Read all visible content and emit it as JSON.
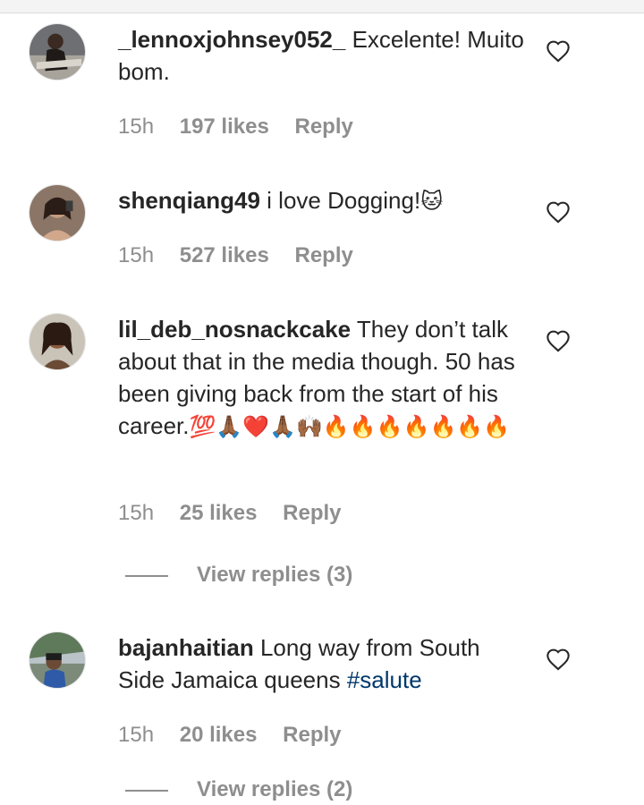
{
  "comments": [
    {
      "username": "_lennoxjohnsey052_",
      "text": "Excelente! Muito bom.",
      "emoji": "",
      "hashtag": "",
      "time": "15h",
      "likes": "197 likes",
      "reply": "Reply"
    },
    {
      "username": "shenqiang49",
      "text": "i love Dogging!",
      "emoji": "🐱",
      "hashtag": "",
      "time": "15h",
      "likes": "527 likes",
      "reply": "Reply"
    },
    {
      "username": "lil_deb_nosnackcake",
      "text": "They don’t talk about that in the media though. 50 has been giving back from the start of his career.",
      "emoji": "💯🙏🏾❤️🙏🏾🙌🏾🔥🔥🔥🔥🔥🔥🔥",
      "hashtag": "",
      "time": "15h",
      "likes": "25 likes",
      "reply": "Reply",
      "view_replies": "View replies (3)"
    },
    {
      "username": "bajanhaitian",
      "text": "Long way from South Side Jamaica queens",
      "emoji": "",
      "hashtag": "#salute",
      "time": "15h",
      "likes": "20 likes",
      "reply": "Reply",
      "view_replies": "View replies (2)"
    }
  ],
  "icons": {
    "like": "heart-outline-icon"
  },
  "colors": {
    "text": "#262626",
    "meta": "#8e8e8e",
    "hashtag": "#00376b"
  }
}
